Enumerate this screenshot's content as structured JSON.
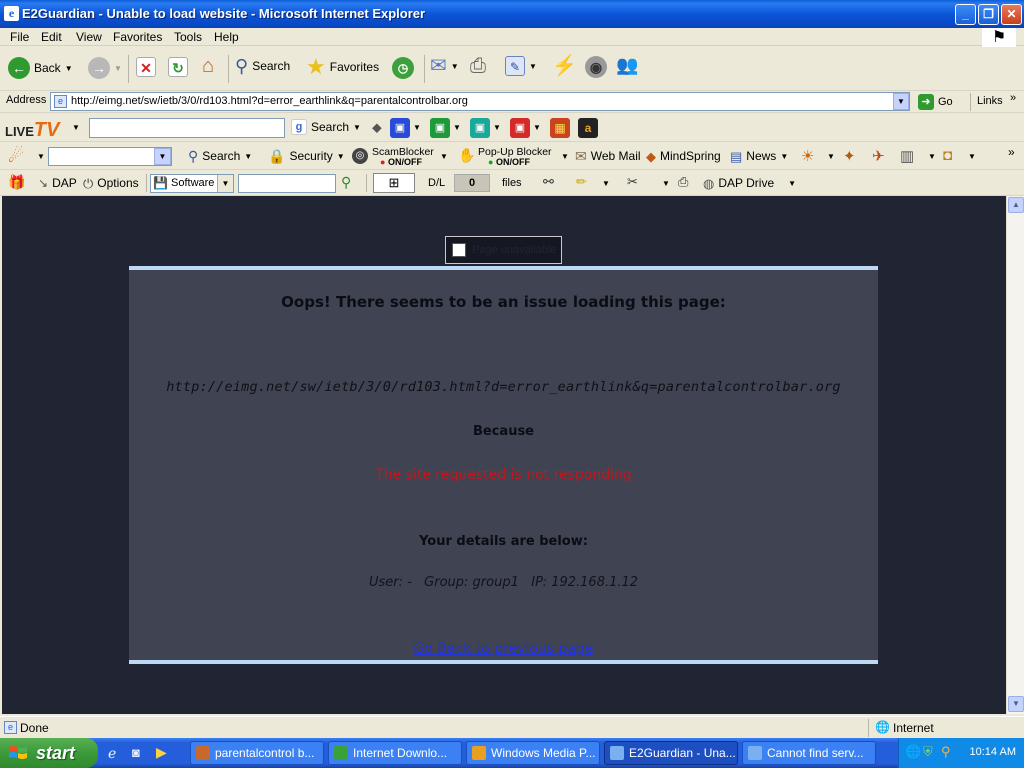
{
  "window": {
    "title": "E2Guardian - Unable to load website - Microsoft Internet Explorer",
    "buttons": {
      "minimize": "_",
      "maximize": "❐",
      "close": "✕"
    }
  },
  "menu": [
    "File",
    "Edit",
    "View",
    "Favorites",
    "Tools",
    "Help"
  ],
  "nav_toolbar": {
    "back_label": "Back",
    "search_label": "Search",
    "favorites_label": "Favorites"
  },
  "address_bar": {
    "label": "Address",
    "url": "http://eimg.net/sw/ietb/3/0/rd103.html?d=error_earthlink&q=parentalcontrolbar.org",
    "go_label": "Go",
    "links_label": "Links"
  },
  "livetv_toolbar": {
    "logo_live": "LIVE",
    "logo_tv": "TV",
    "search_label": "Search"
  },
  "earthlink_toolbar": {
    "search_label": "Search",
    "security_label": "Security",
    "scamblocker_label": "ScamBlocker",
    "scamblocker_state": "ON/OFF",
    "popup_label": "Pop-Up Blocker",
    "popup_state": "ON/OFF",
    "webmail_label": "Web Mail",
    "mindspring_label": "MindSpring",
    "news_label": "News"
  },
  "dap_toolbar": {
    "dap_label": "DAP",
    "options_label": "Options",
    "software_label": "Software",
    "dl_label": "D/L",
    "dl_count": "0",
    "files_label": "files",
    "dapdrive_label": "DAP Drive"
  },
  "page": {
    "tab_label": "Page unavailable",
    "heading": "Oops! There seems to be an issue loading this page:",
    "url": "http://eimg.net/sw/ietb/3/0/rd103.html?d=error_earthlink&q=parentalcontrolbar.org",
    "because_label": "Because",
    "reason": "The site requested is not responding",
    "details_heading": "Your details are below:",
    "details": "User: -   Group: group1   IP: 192.168.1.12",
    "go_back_link": "Go Back to previous page"
  },
  "status_bar": {
    "status": "Done",
    "zone": "Internet"
  },
  "taskbar": {
    "start_label": "start",
    "tasks": [
      {
        "label": "parentalcontrol b...",
        "active": false
      },
      {
        "label": "Internet Downlo...",
        "active": false
      },
      {
        "label": "Windows Media P...",
        "active": false
      },
      {
        "label": "E2Guardian - Una...",
        "active": true
      },
      {
        "label": "Cannot find serv...",
        "active": false
      }
    ],
    "clock": "10:14 AM"
  },
  "colors": {
    "page_background": "#202433",
    "panel_background": "#3f4352",
    "panel_border": "#bcd8f4",
    "reason_text": "#c4161c",
    "link": "#2233dd"
  },
  "icons": [
    "ie-icon",
    "back-icon",
    "forward-icon",
    "stop-icon",
    "refresh-icon",
    "home-icon",
    "search-icon",
    "favorites-star-icon",
    "history-icon",
    "mail-icon",
    "print-icon",
    "edit-icon",
    "messenger-icon",
    "windows-flag-icon",
    "google-icon",
    "earthlink-icon",
    "dap-gift-icon",
    "start-windows-logo-icon"
  ]
}
